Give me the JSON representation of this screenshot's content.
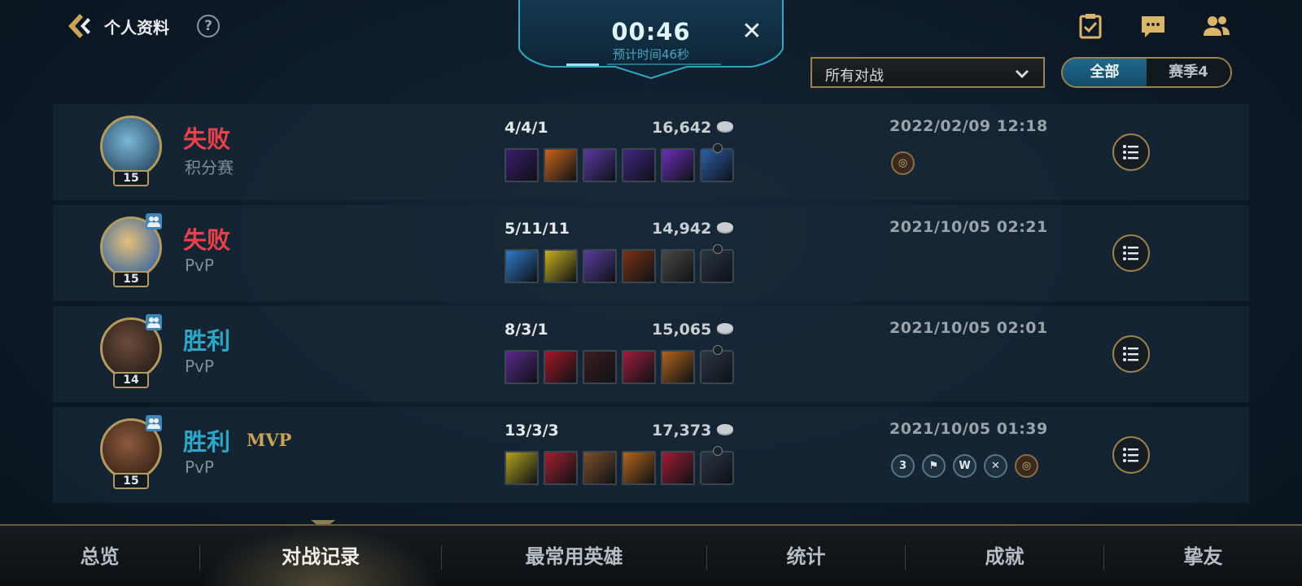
{
  "header": {
    "title": "个人资料",
    "help": "?"
  },
  "queue": {
    "timer": "00:46",
    "eta": "预计时间46秒",
    "close": "✕"
  },
  "filter": {
    "selected": "所有对战"
  },
  "segment": {
    "tabs": [
      "全部",
      "赛季4"
    ],
    "active": "全部"
  },
  "matches": [
    {
      "result": "失败",
      "outcome": "loss",
      "mode": "积分赛",
      "level": "15",
      "party": false,
      "mvp": "",
      "kda": "4/4/1",
      "gold": "16,642",
      "date": "2022/02/09 12:18",
      "items": [
        "#3a1c6b",
        "#c9631a",
        "#5a3aa3",
        "#412680",
        "#6b2fb8",
        "#2f5fa8"
      ],
      "badges": [
        {
          "label": "◎",
          "style": "bronze"
        }
      ],
      "avatar_colors": [
        "#7ab7d6",
        "#2b4d66"
      ]
    },
    {
      "result": "失败",
      "outcome": "loss",
      "mode": "PvP",
      "level": "15",
      "party": true,
      "mvp": "",
      "kda": "5/11/11",
      "gold": "14,942",
      "date": "2021/10/05 02:21",
      "items": [
        "#2e79c8",
        "#c8b01e",
        "#5a3e9c",
        "#7a3315",
        "#4a4a44",
        "#2a3644"
      ],
      "badges": [],
      "avatar_colors": [
        "#e6c07a",
        "#3f6aa0"
      ]
    },
    {
      "result": "胜利",
      "outcome": "win",
      "mode": "PvP",
      "level": "14",
      "party": true,
      "mvp": "",
      "kda": "8/3/1",
      "gold": "15,065",
      "date": "2021/10/05 02:01",
      "items": [
        "#5b2a8a",
        "#a31828",
        "#3b1e22",
        "#9d1e3a",
        "#b0631c",
        "#2a3644"
      ],
      "badges": [],
      "avatar_colors": [
        "#6b4b3a",
        "#2a1f1a"
      ]
    },
    {
      "result": "胜利",
      "outcome": "win",
      "mode": "PvP",
      "level": "15",
      "party": true,
      "mvp": "MVP",
      "kda": "13/3/3",
      "gold": "17,373",
      "date": "2021/10/05 01:39",
      "items": [
        "#b3a11e",
        "#a3202e",
        "#7c4f2a",
        "#b3661a",
        "#a01c34",
        "#2a3644"
      ],
      "badges": [
        {
          "label": "3",
          "style": "silver"
        },
        {
          "label": "⚑",
          "style": "silver"
        },
        {
          "label": "W",
          "style": "silver"
        },
        {
          "label": "✕",
          "style": "silver"
        },
        {
          "label": "◎",
          "style": "bronze"
        }
      ],
      "avatar_colors": [
        "#8a5a3c",
        "#3a2418"
      ]
    }
  ],
  "nav": {
    "items": [
      "总览",
      "对战记录",
      "最常用英雄",
      "统计",
      "成就",
      "挚友"
    ],
    "active": "对战记录"
  },
  "colors": {
    "accent_gold": "#9b8350",
    "loss": "#e9414b",
    "win": "#2aa6c6",
    "segment_active": "#1f6a8e"
  },
  "icons": {
    "back": "back-chevron-icon",
    "help": "help-icon",
    "missions": "missions-clipboard-icon",
    "chat": "chat-icon",
    "friends": "friends-icon",
    "gold": "gold-coin-icon",
    "detail": "list-icon",
    "dropdown": "chevron-down-icon"
  }
}
